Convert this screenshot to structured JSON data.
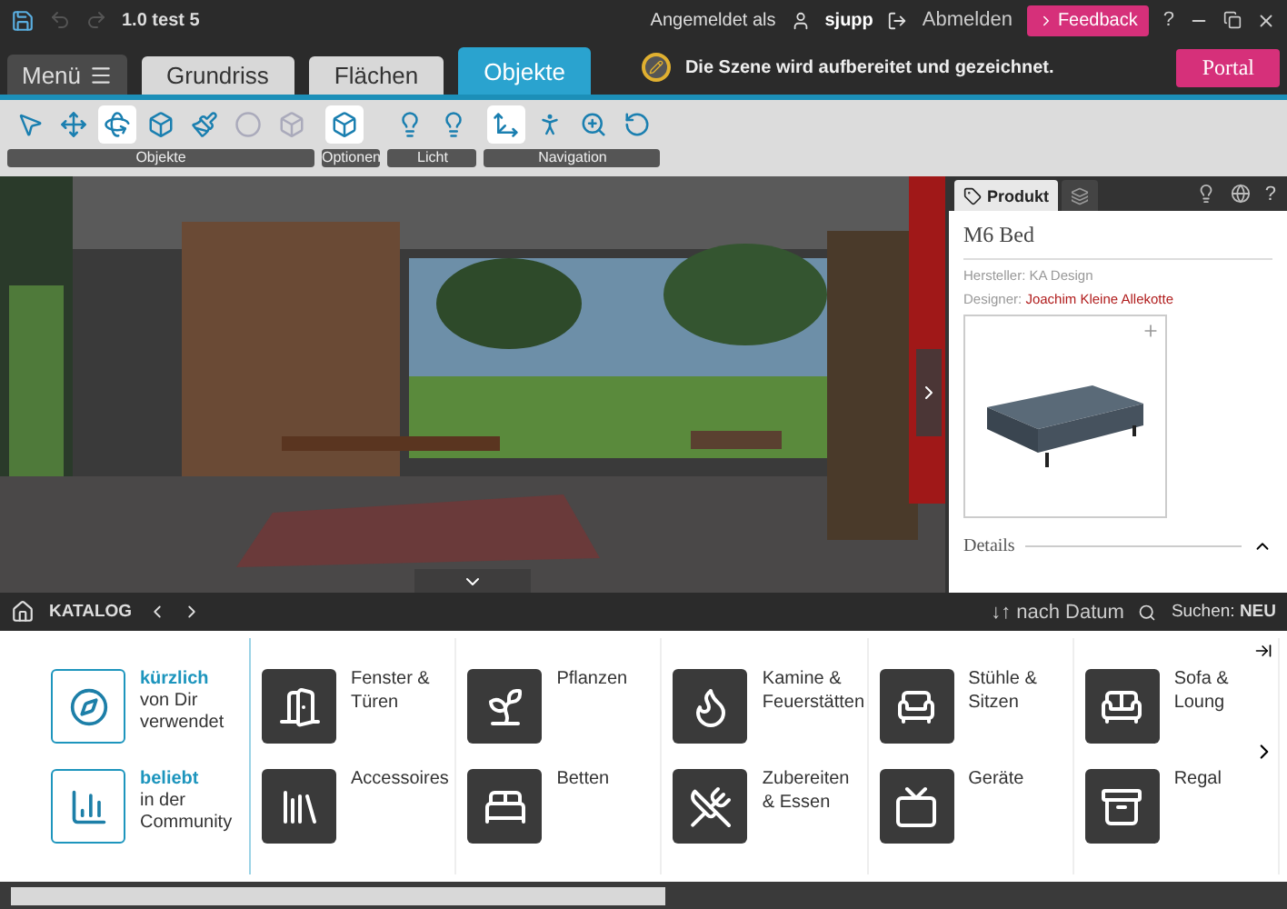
{
  "title_bar": {
    "project": "1.0 test 5",
    "undo_disabled": true,
    "redo_disabled": true,
    "logged_in_label": "Angemeldet als",
    "user": "sjupp",
    "logout": "Abmelden",
    "feedback": "Feedback",
    "help": "?"
  },
  "tabs": [
    {
      "label": "Grundriss",
      "selected": false
    },
    {
      "label": "Flächen",
      "selected": false
    },
    {
      "label": "Objekte",
      "selected": true
    }
  ],
  "menu": "Menü",
  "status": "Die Szene wird aufbereitet und gezeichnet.",
  "portal": "Portal",
  "toolbar": [
    {
      "label": "Objekte",
      "tools": [
        {
          "selected": false,
          "disabled": false
        },
        {
          "selected": false,
          "disabled": false
        },
        {
          "selected": true,
          "disabled": false
        },
        {
          "selected": false,
          "disabled": false
        },
        {
          "selected": false,
          "disabled": false
        },
        {
          "selected": false,
          "disabled": true
        },
        {
          "selected": false,
          "disabled": true
        }
      ]
    },
    {
      "label": "Optionen",
      "tools": [
        {
          "selected": true,
          "disabled": false
        }
      ]
    },
    {
      "label": "Licht",
      "tools": [
        {
          "selected": false,
          "disabled": false
        },
        {
          "selected": false,
          "disabled": false
        }
      ]
    },
    {
      "label": "Navigation",
      "tools": [
        {
          "selected": true,
          "disabled": false
        },
        {
          "selected": false,
          "disabled": false
        },
        {
          "selected": false,
          "disabled": false
        },
        {
          "selected": false,
          "disabled": false
        }
      ]
    }
  ],
  "product_panel": {
    "tabs": [
      {
        "label": "Produkt",
        "selected": true
      },
      {
        "selected": false
      }
    ],
    "help": "?",
    "name": "M6 Bed",
    "manufacturer": "Hersteller: KA Design",
    "designer_label": "Designer:",
    "designer": "Joachim Kleine Allekotte",
    "details": "Details",
    "details_expanded": true
  },
  "catalog_bar": {
    "title": "KATALOG",
    "sort": "↓↑ nach Datum",
    "search": "Suchen: **NEU**"
  },
  "catalog": {
    "shortcuts": [
      {
        "highlight": "kürzlich",
        "text": "von Dir verwendet"
      },
      {
        "highlight": "beliebt",
        "text": "in der Community"
      }
    ],
    "columns": [
      {
        "items": [
          "Fenster & Türen",
          "Accessoires"
        ]
      },
      {
        "items": [
          "Pflanzen",
          "Betten"
        ]
      },
      {
        "items": [
          "Kamine & Feuerstätten",
          "Zubereiten & Essen"
        ]
      },
      {
        "items": [
          "Stühle & Sitzen",
          "Geräte"
        ]
      },
      {
        "items": [
          "Sofa & Loung",
          "Regal"
        ]
      }
    ]
  }
}
